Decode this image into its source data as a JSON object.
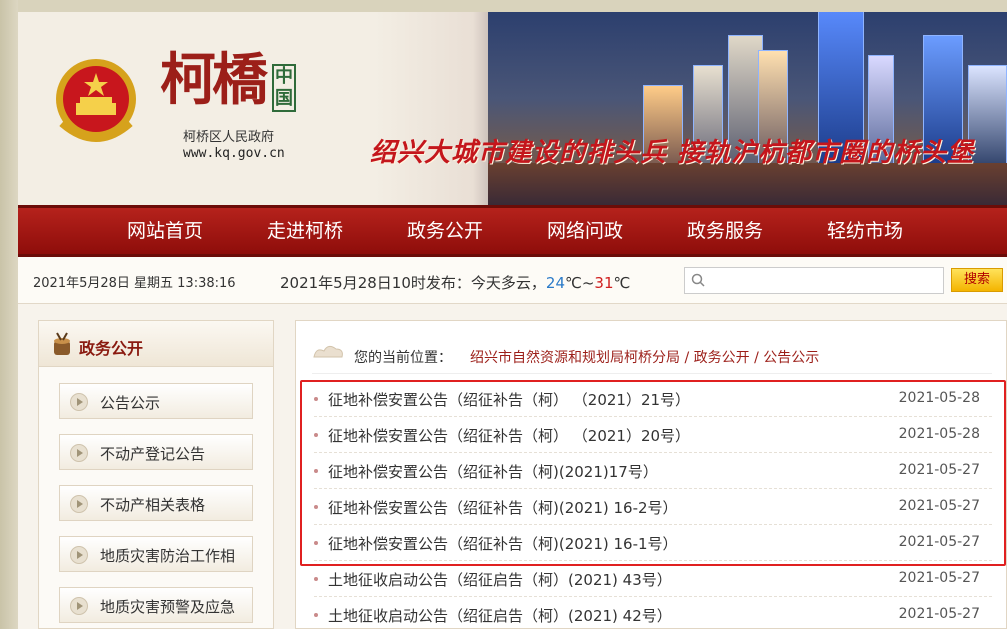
{
  "header": {
    "logo_text": "柯橋",
    "logo_seal": "中国",
    "gov_name": "柯桥区人民政府",
    "gov_url": "www.kq.gov.cn",
    "slogan": "绍兴大城市建设的排头兵 接轨沪杭都市圈的桥头堡"
  },
  "nav": {
    "items": [
      "网站首页",
      "走进柯桥",
      "政务公开",
      "网络问政",
      "政务服务",
      "轻纺市场"
    ]
  },
  "infobar": {
    "datetime": "2021年5月28日 星期五 13:38:16",
    "weather_prefix": "2021年5月28日10时发布：今天多云，",
    "temp_low": "24",
    "temp_sep": "℃~",
    "temp_high": "31",
    "temp_unit": "℃",
    "search_placeholder": "",
    "search_button": "搜索"
  },
  "sidebar": {
    "title": "政务公开",
    "items": [
      "公告公示",
      "不动产登记公告",
      "不动产相关表格",
      "地质灾害防治工作相",
      "地质灾害预警及应急"
    ]
  },
  "breadcrumb": {
    "label": "您的当前位置：",
    "path": [
      "绍兴市自然资源和规划局柯桥分局",
      "政务公开",
      "公告公示"
    ],
    "sep": " / "
  },
  "news": [
    {
      "title": "征地补偿安置公告（绍征补告（柯） （2021）21号）",
      "date": "2021-05-28"
    },
    {
      "title": "征地补偿安置公告（绍征补告（柯） （2021）20号）",
      "date": "2021-05-28"
    },
    {
      "title": "征地补偿安置公告（绍征补告（柯)(2021)17号）",
      "date": "2021-05-27"
    },
    {
      "title": "征地补偿安置公告（绍征补告（柯)(2021) 16-2号）",
      "date": "2021-05-27"
    },
    {
      "title": "征地补偿安置公告（绍征补告（柯)(2021) 16-1号）",
      "date": "2021-05-27"
    },
    {
      "title": "土地征收启动公告（绍征启告（柯）(2021) 43号）",
      "date": "2021-05-27"
    },
    {
      "title": "土地征收启动公告（绍征启告（柯）(2021) 42号）",
      "date": "2021-05-27"
    }
  ],
  "colors": {
    "brand_red": "#9c1f19",
    "nav_red": "#b5221c",
    "highlight": "#e02020"
  }
}
